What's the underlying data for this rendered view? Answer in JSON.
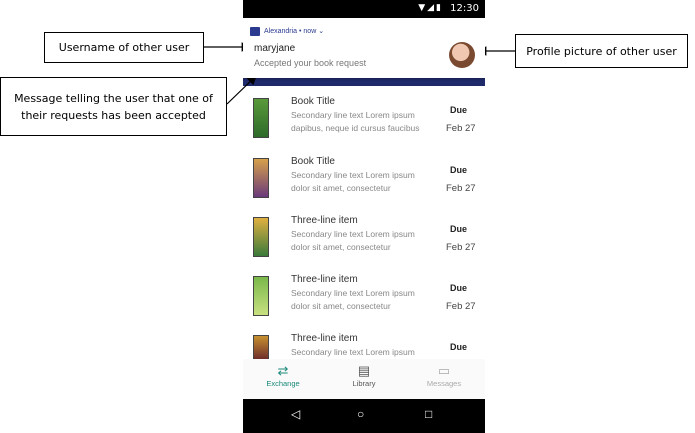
{
  "status_bar": {
    "time": "12:30",
    "icons": [
      "wifi-icon",
      "signal-icon",
      "battery-icon"
    ]
  },
  "notification": {
    "app_name": "Alexandria • now",
    "sender": "maryjane",
    "message": "Accepted your book request"
  },
  "books": [
    {
      "title": "Book Title",
      "line2": "Secondary line text Lorem ipsum",
      "line3": "dapibus, neque id cursus faucibus",
      "due_label": "Due",
      "due_date": "Feb 27"
    },
    {
      "title": "Book Title",
      "line2": "Secondary line text Lorem ipsum",
      "line3": "dolor sit amet, consectetur",
      "due_label": "Due",
      "due_date": "Feb 27"
    },
    {
      "title": "Three-line item",
      "line2": "Secondary line text Lorem ipsum",
      "line3": "dolor sit amet, consectetur",
      "due_label": "Due",
      "due_date": "Feb 27"
    },
    {
      "title": "Three-line item",
      "line2": "Secondary line text Lorem ipsum",
      "line3": "dolor sit amet, consectetur",
      "due_label": "Due",
      "due_date": "Feb 27"
    },
    {
      "title": "Three-line item",
      "line2": "Secondary line text Lorem ipsum",
      "line3": "",
      "due_label": "Due",
      "due_date": ""
    }
  ],
  "bottom_nav": [
    {
      "label": "Exchange",
      "icon": "exchange-icon"
    },
    {
      "label": "Library",
      "icon": "library-icon"
    },
    {
      "label": "Messages",
      "icon": "messages-icon"
    }
  ],
  "system_nav": {
    "icons": [
      "back-icon",
      "home-icon",
      "recents-icon"
    ]
  },
  "callouts": {
    "username": "Username of other user",
    "profile": "Profile picture of other user",
    "message": "Message telling the user that one of their requests has been accepted"
  },
  "colors": {
    "brand": "#1f2a6b",
    "accent": "#1a8a7a"
  }
}
